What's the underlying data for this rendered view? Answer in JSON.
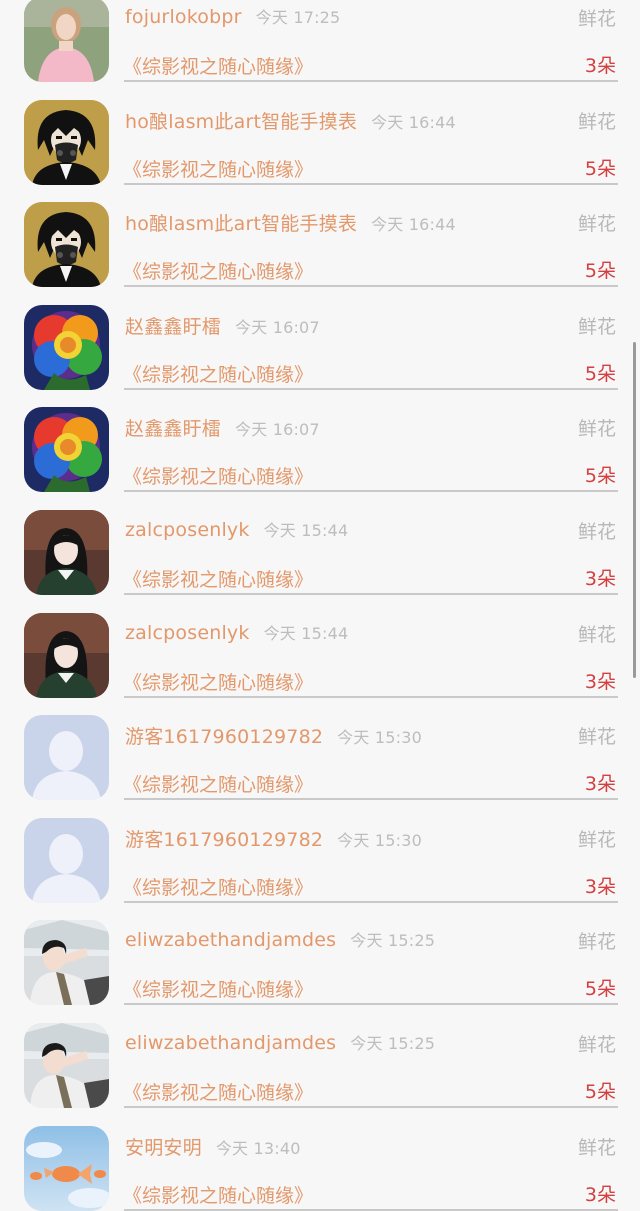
{
  "gift_rows": [
    {
      "username": "fojurlokobpr",
      "time": "今天 17:25",
      "gift_label": "鲜花",
      "work_title": "《综影视之随心随缘》",
      "count": "3朵",
      "avatar": "girl-pink-avatar"
    },
    {
      "username": "ho酿lasm此art智能手摸表",
      "time": "今天 16:44",
      "gift_label": "鲜花",
      "work_title": "《综影视之随心随缘》",
      "count": "5朵",
      "avatar": "masked-boy-avatar"
    },
    {
      "username": "ho酿lasm此art智能手摸表",
      "time": "今天 16:44",
      "gift_label": "鲜花",
      "work_title": "《综影视之随心随缘》",
      "count": "5朵",
      "avatar": "masked-boy-avatar"
    },
    {
      "username": "赵鑫鑫盱檑",
      "time": "今天 16:07",
      "gift_label": "鲜花",
      "work_title": "《综影视之随心随缘》",
      "count": "5朵",
      "avatar": "rainbow-rose-avatar"
    },
    {
      "username": "赵鑫鑫盱檑",
      "time": "今天 16:07",
      "gift_label": "鲜花",
      "work_title": "《综影视之随心随缘》",
      "count": "5朵",
      "avatar": "rainbow-rose-avatar"
    },
    {
      "username": "zalcposenlyk",
      "time": "今天 15:44",
      "gift_label": "鲜花",
      "work_title": "《综影视之随心随缘》",
      "count": "3朵",
      "avatar": "girl-dark-hair-avatar"
    },
    {
      "username": "zalcposenlyk",
      "time": "今天 15:44",
      "gift_label": "鲜花",
      "work_title": "《综影视之随心随缘》",
      "count": "3朵",
      "avatar": "girl-dark-hair-avatar"
    },
    {
      "username": "游客1617960129782",
      "time": "今天 15:30",
      "gift_label": "鲜花",
      "work_title": "《综影视之随心随缘》",
      "count": "3朵",
      "avatar": "default-user-avatar"
    },
    {
      "username": "游客1617960129782",
      "time": "今天 15:30",
      "gift_label": "鲜花",
      "work_title": "《综影视之随心随缘》",
      "count": "3朵",
      "avatar": "default-user-avatar"
    },
    {
      "username": "eliwzabethandjamdes",
      "time": "今天 15:25",
      "gift_label": "鲜花",
      "work_title": "《综影视之随心随缘》",
      "count": "5朵",
      "avatar": "car-selfie-avatar"
    },
    {
      "username": "eliwzabethandjamdes",
      "time": "今天 15:25",
      "gift_label": "鲜花",
      "work_title": "《综影视之随心随缘》",
      "count": "5朵",
      "avatar": "car-selfie-avatar"
    },
    {
      "username": "安明安明",
      "time": "今天 13:40",
      "gift_label": "鲜花",
      "work_title": "《综影视之随心随缘》",
      "count": "3朵",
      "avatar": "goldfish-sky-avatar"
    }
  ],
  "colors": {
    "name_accent": "#e3986b",
    "count_red": "#d43f3f",
    "muted_gray": "#b8b8b8"
  }
}
